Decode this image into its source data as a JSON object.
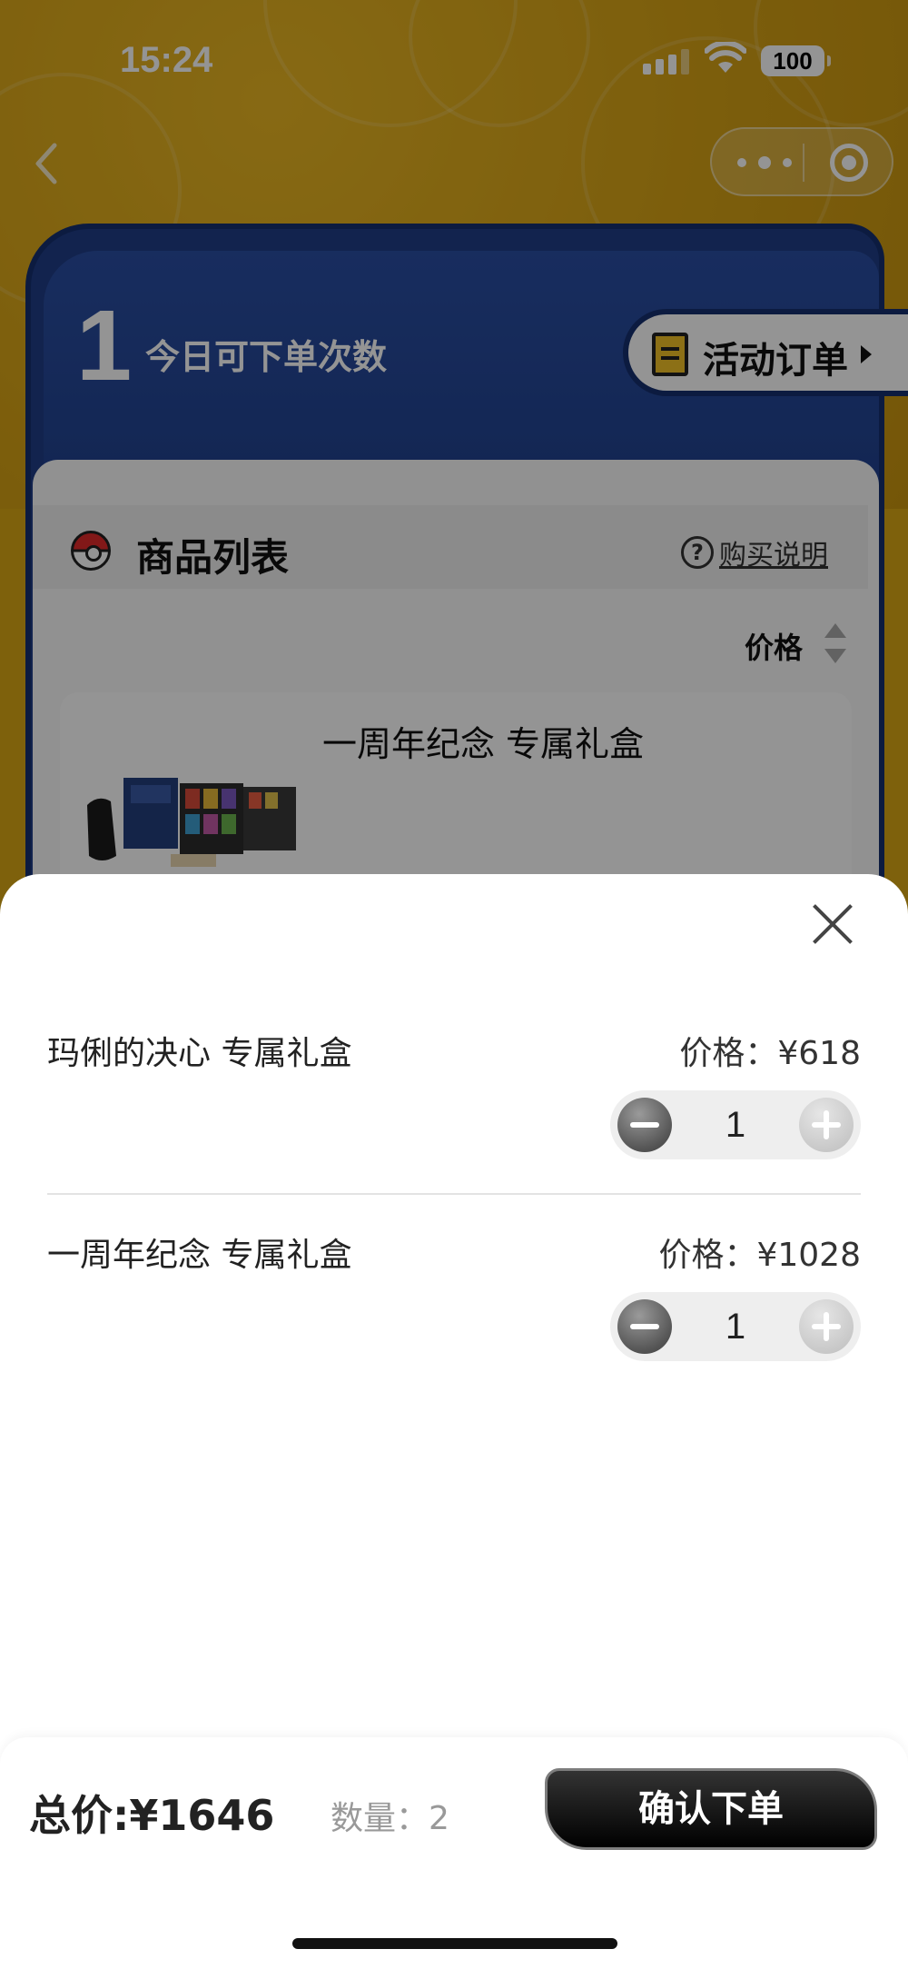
{
  "status_bar": {
    "time": "15:24",
    "battery": "100"
  },
  "header": {
    "today_count": "1",
    "today_label": "今日可下单次数",
    "orders_button": "活动订单"
  },
  "product_list": {
    "title": "商品列表",
    "help_text": "购买说明",
    "sort_label": "价格",
    "first_product_name": "一周年纪念 专属礼盒"
  },
  "cart": {
    "items": [
      {
        "name": "玛俐的决心 专属礼盒",
        "price": "价格：¥618",
        "qty": "1"
      },
      {
        "name": "一周年纪念 专属礼盒",
        "price": "价格：¥1028",
        "qty": "1"
      }
    ]
  },
  "footer": {
    "total": "总价:¥1646",
    "count": "数量：2",
    "confirm": "确认下单"
  },
  "colors": {
    "background_yellow": "#d9a716",
    "card_blue": "#1f3d87",
    "confirm_black": "#000000"
  }
}
